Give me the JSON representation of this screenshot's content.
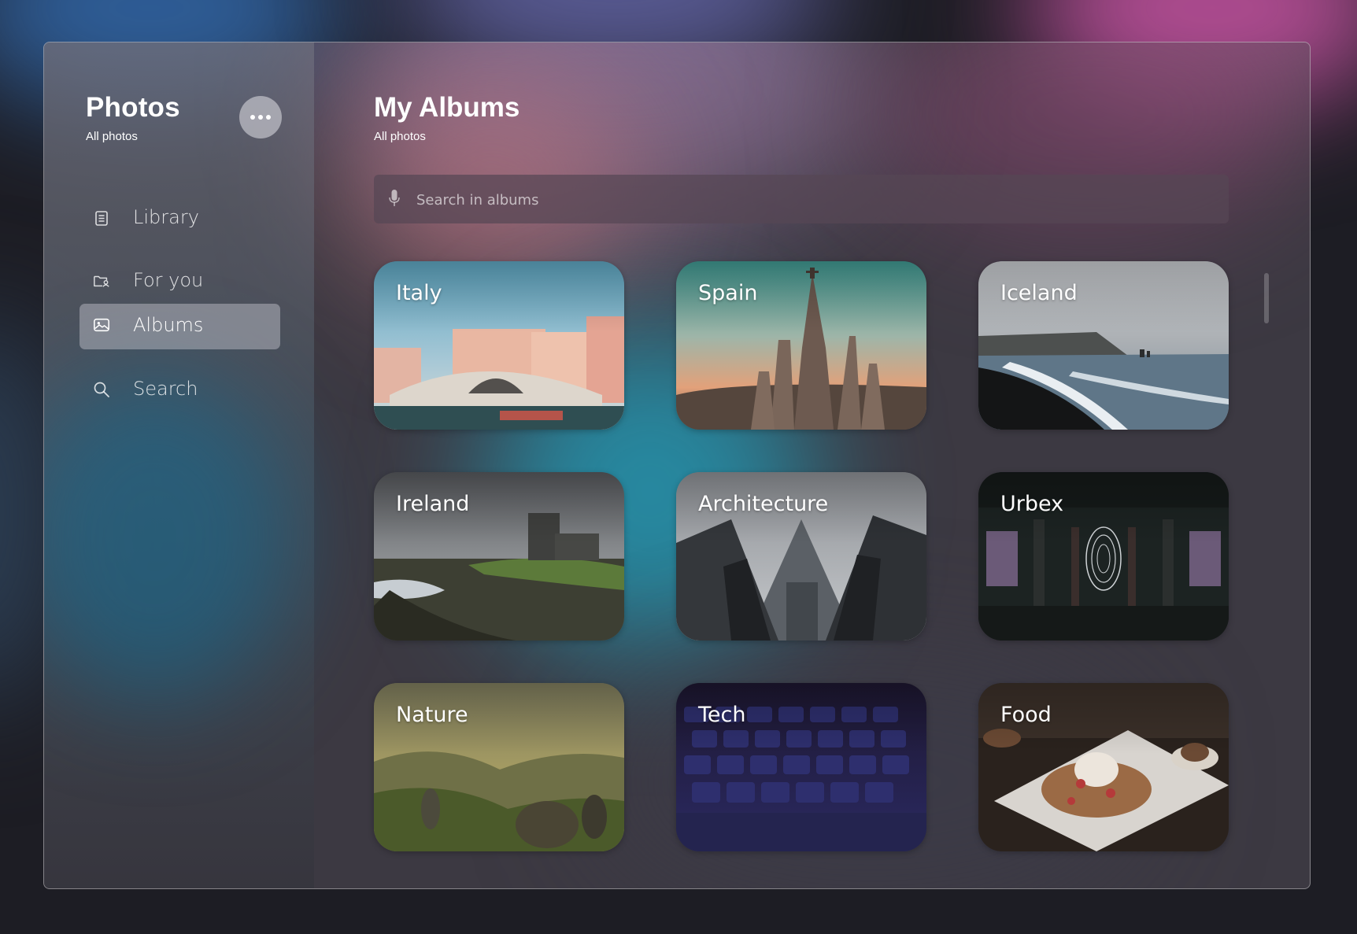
{
  "sidebar": {
    "title": "Photos",
    "subtitle": "All photos",
    "more_icon": "ellipsis-icon",
    "items": [
      {
        "label": "Library",
        "icon": "library-icon",
        "active": false
      },
      {
        "label": "For you",
        "icon": "folder-user-icon",
        "active": false
      },
      {
        "label": "Albums",
        "icon": "image-album-icon",
        "active": true
      },
      {
        "label": "Search",
        "icon": "search-icon",
        "active": false
      }
    ]
  },
  "main": {
    "title": "My Albums",
    "subtitle": "All photos",
    "search": {
      "placeholder": "Search in albums",
      "value": "",
      "icon": "microphone-icon"
    },
    "albums": [
      {
        "label": "Italy"
      },
      {
        "label": "Spain"
      },
      {
        "label": "Iceland"
      },
      {
        "label": "Ireland"
      },
      {
        "label": "Architecture"
      },
      {
        "label": "Urbex"
      },
      {
        "label": "Nature"
      },
      {
        "label": "Tech"
      },
      {
        "label": "Food"
      }
    ]
  },
  "colors": {
    "active_nav_bg": "#a7a7b0",
    "accent_text": "#ffffff"
  }
}
